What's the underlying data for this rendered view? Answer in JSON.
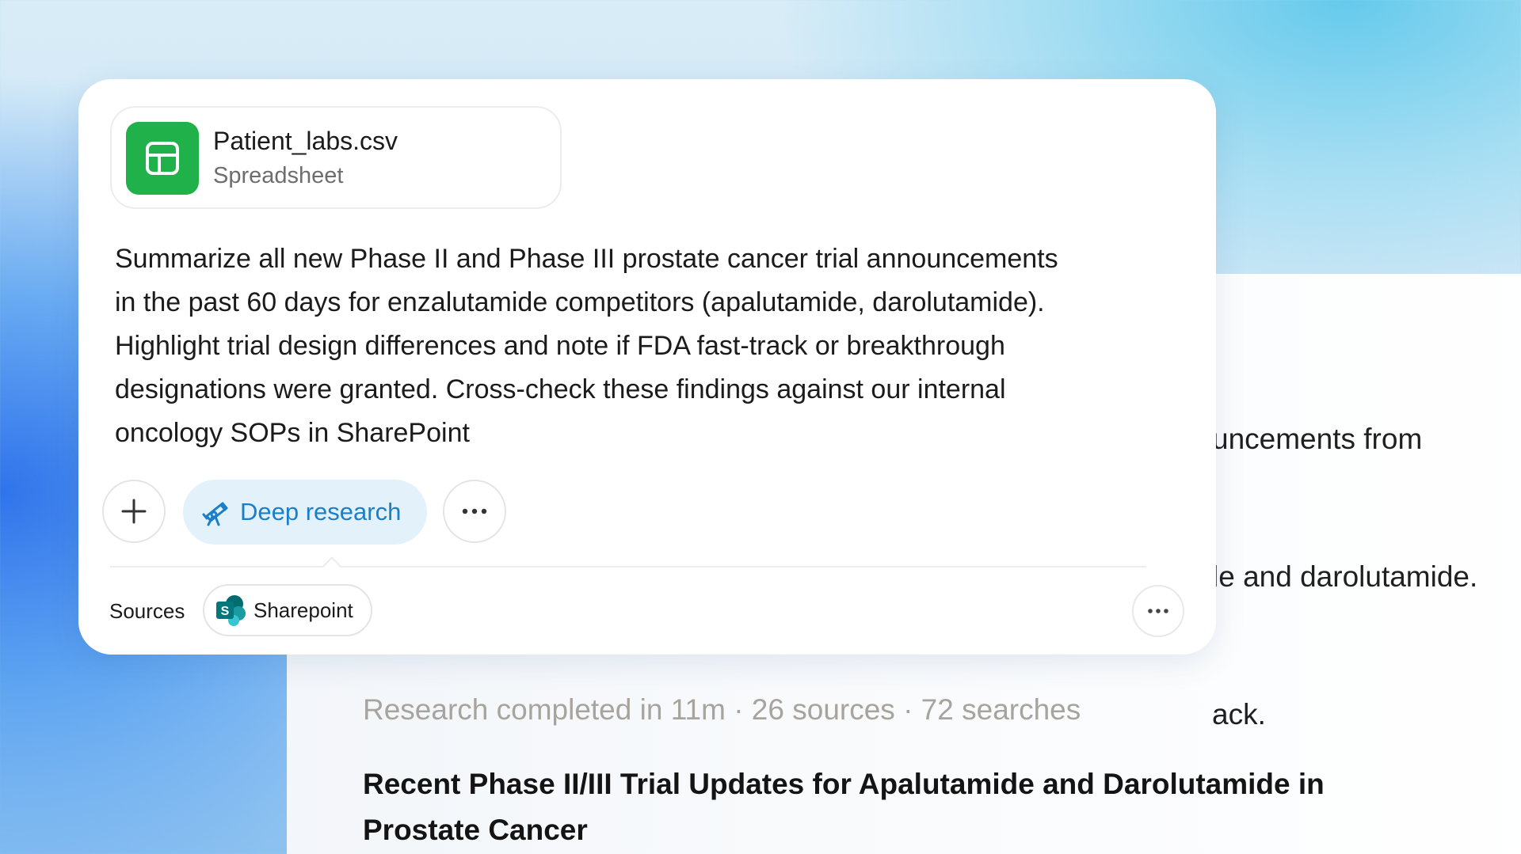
{
  "attachment": {
    "name": "Patient_labs.csv",
    "type": "Spreadsheet",
    "icon": "spreadsheet-icon",
    "icon_color": "#21b14a"
  },
  "prompt": {
    "lines": [
      "Summarize all new Phase II and Phase III prostate cancer trial announcements",
      "in the past 60 days for enzalutamide competitors (apalutamide, darolutamide).",
      "Highlight trial design differences and note if FDA fast-track or breakthrough",
      "designations were granted. Cross-check these findings against our internal",
      "oncology SOPs in SharePoint"
    ]
  },
  "toolbar": {
    "add_icon": "plus-icon",
    "deep_research_label": "Deep research",
    "deep_research_icon": "telescope-icon",
    "more_icon": "more-horizontal-icon",
    "accent_color": "#1a7fc9"
  },
  "sources": {
    "label": "Sources",
    "items": [
      {
        "label": "Sharepoint",
        "icon": "sharepoint-icon"
      }
    ],
    "more_icon": "more-horizontal-icon"
  },
  "background_response": {
    "partial_lines": [
      "uncements from",
      "le and darolutamide.",
      "ack."
    ],
    "meta": "Research completed in 11m · 26 sources · 72 searches",
    "title": "Recent Phase II/III Trial Updates for Apalutamide and Darolutamide in Prostate Cancer"
  }
}
